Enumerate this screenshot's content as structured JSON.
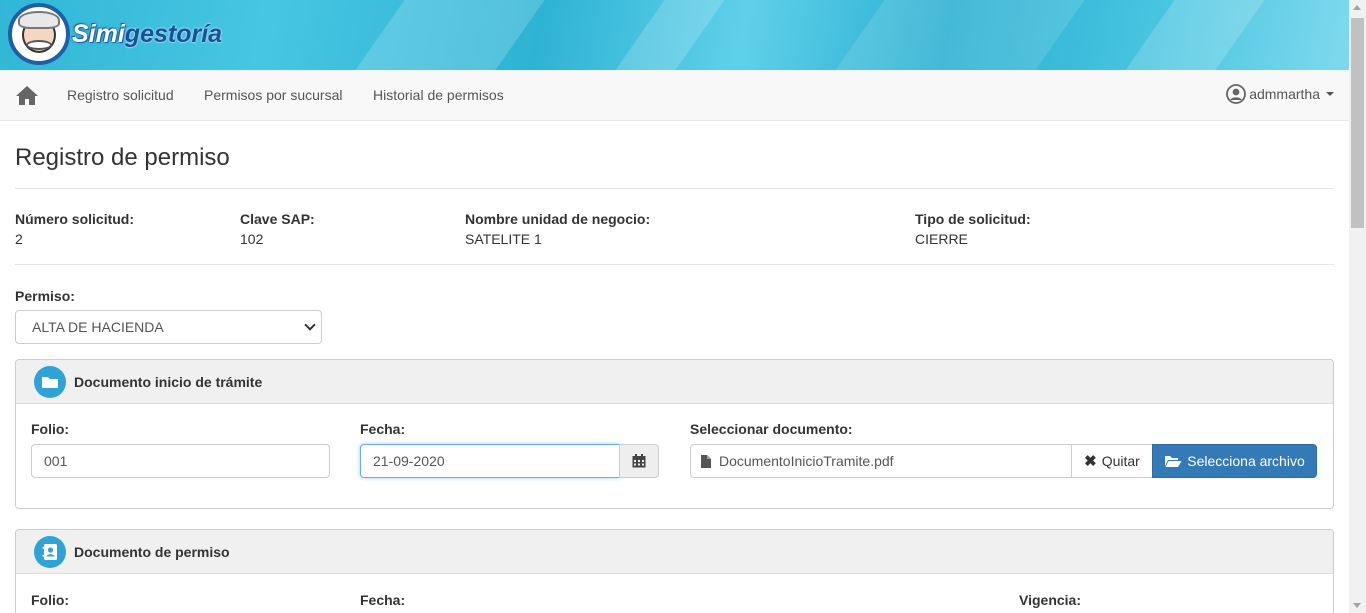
{
  "brand": {
    "name_part1": "Simi",
    "name_part2": "gestoría"
  },
  "nav": {
    "links": [
      "Registro solicitud",
      "Permisos por sucursal",
      "Historial de permisos"
    ],
    "user": "admmartha"
  },
  "page": {
    "title": "Registro de permiso"
  },
  "request": {
    "numero_label": "Número solicitud:",
    "numero_value": "2",
    "clave_label": "Clave SAP:",
    "clave_value": "102",
    "nombre_label": "Nombre unidad de negocio:",
    "nombre_value": "SATELITE 1",
    "tipo_label": "Tipo de solicitud:",
    "tipo_value": "CIERRE"
  },
  "permiso": {
    "label": "Permiso:",
    "selected": "ALTA DE HACIENDA"
  },
  "panel_inicio": {
    "title": "Documento inicio de trámite",
    "folio_label": "Folio:",
    "folio_value": "001",
    "fecha_label": "Fecha:",
    "fecha_value": "21-09-2020",
    "doc_label": "Seleccionar documento:",
    "doc_file": "DocumentoInicioTramite.pdf",
    "quitar_label": "Quitar",
    "select_label": "Selecciona archivo"
  },
  "panel_permiso": {
    "title": "Documento de permiso",
    "folio_label": "Folio:",
    "fecha_label": "Fecha:",
    "vigencia_label": "Vigencia:"
  },
  "colors": {
    "accent": "#337ab7",
    "icon_circle": "#2fa3d5",
    "banner": "#31b7d6"
  },
  "icons": [
    "home-icon",
    "user-circle-icon",
    "folder-icon",
    "calendar-icon",
    "file-icon",
    "close-icon",
    "folder-open-icon",
    "contact-book-icon"
  ]
}
